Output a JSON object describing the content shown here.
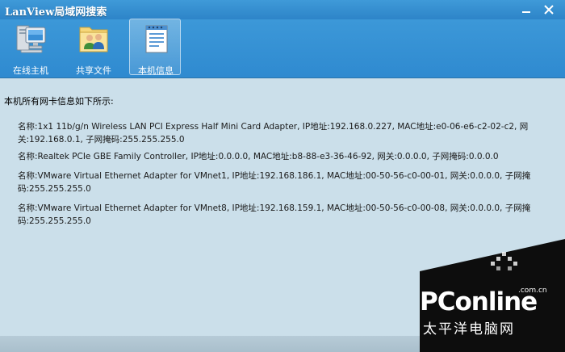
{
  "window": {
    "title": "LanView局域网搜索"
  },
  "toolbar": {
    "buttons": [
      {
        "label": "在线主机",
        "icon": "computer-icon",
        "active": false
      },
      {
        "label": "共享文件",
        "icon": "shared-folder-icon",
        "active": false
      },
      {
        "label": "本机信息",
        "icon": "notepad-icon",
        "active": true
      }
    ]
  },
  "content": {
    "heading": "本机所有网卡信息如下所示:",
    "adapters": [
      "名称:1x1 11b/g/n Wireless LAN PCI Express Half Mini Card Adapter, IP地址:192.168.0.227, MAC地址:e0-06-e6-c2-02-c2, 网关:192.168.0.1, 子网掩码:255.255.255.0",
      "名称:Realtek PCIe GBE Family Controller, IP地址:0.0.0.0, MAC地址:b8-88-e3-36-46-92, 网关:0.0.0.0, 子网掩码:0.0.0.0",
      "名称:VMware Virtual Ethernet Adapter for VMnet1, IP地址:192.168.186.1, MAC地址:00-50-56-c0-00-01, 网关:0.0.0.0, 子网掩码:255.255.255.0",
      "名称:VMware Virtual Ethernet Adapter for VMnet8, IP地址:192.168.159.1, MAC地址:00-50-56-c0-00-08, 网关:0.0.0.0, 子网掩码:255.255.255.0"
    ]
  },
  "watermark": {
    "brand": "PConline",
    "domain": ".com.cn",
    "tagline": "太平洋电脑网"
  },
  "colors": {
    "titlebar": "#2d84c8",
    "toolbar": "#3c98d8",
    "content_bg": "#cbdfea"
  }
}
